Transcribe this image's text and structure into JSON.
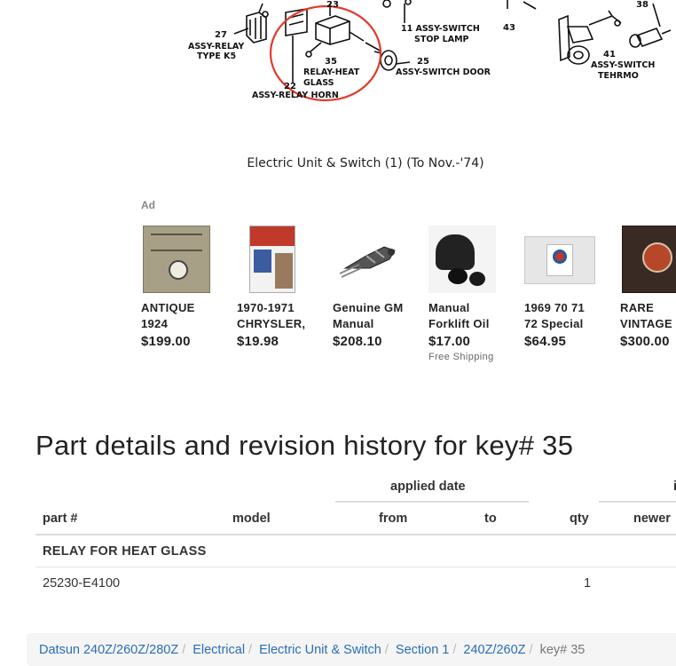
{
  "diagram": {
    "labels": {
      "n27": "27",
      "relay_k5_1": "ASSY-RELAY",
      "relay_k5_2": "TYPE K5",
      "n22": "22",
      "relay_horn": "ASSY-RELAY HORN",
      "n23": "23",
      "n35": "35",
      "relay_heat_1": "RELAY-HEAT",
      "relay_heat_2": "GLASS",
      "stop_1": "11 ASSY-SWITCH",
      "stop_2": "STOP LAMP",
      "n25": "25",
      "door": "ASSY-SWITCH DOOR",
      "n43": "43",
      "n38": "38",
      "n41": "41",
      "thermo_1": "ASSY-SWITCH",
      "thermo_2": "TEHRMO"
    },
    "caption": "Electric Unit & Switch (1) (To Nov.-'74)",
    "highlight_color": "#e03b2d"
  },
  "ad": {
    "label": "Ad",
    "items": [
      {
        "title_1": "ANTIQUE",
        "title_2": "1924",
        "price": "$199.00",
        "shipping": "",
        "thumb": "antique-parts-book"
      },
      {
        "title_1": "1970-1971",
        "title_2": "CHRYSLER,",
        "price": "$19.98",
        "shipping": "",
        "thumb": "chrysler-catalog"
      },
      {
        "title_1": "Genuine GM",
        "title_2": "Manual",
        "price": "$208.10",
        "shipping": "",
        "thumb": "gm-switch"
      },
      {
        "title_1": "Manual",
        "title_2": "Forklift Oil",
        "price": "$17.00",
        "shipping": "Free Shipping",
        "thumb": "forklift-knob"
      },
      {
        "title_1": "1969 70 71",
        "title_2": "72 Special",
        "price": "$64.95",
        "shipping": "",
        "thumb": "display-case"
      },
      {
        "title_1": "RARE",
        "title_2": "VINTAGE",
        "price": "$300.00",
        "shipping": "",
        "thumb": "vintage-binder"
      }
    ]
  },
  "details": {
    "heading": "Part details and revision history for key# 35",
    "group_applied": "applied date",
    "group_revision": "i",
    "columns": {
      "part": "part #",
      "model": "model",
      "from": "from",
      "to": "to",
      "qty": "qty",
      "newer": "newer"
    },
    "group_row": "RELAY FOR HEAT GLASS",
    "rows": [
      {
        "part": "25230-E4100",
        "model": "",
        "from": "",
        "to": "",
        "qty": "1",
        "newer": ""
      }
    ]
  },
  "breadcrumb": [
    "Datsun 240Z/260Z/280Z",
    "Electrical",
    "Electric Unit & Switch",
    "Section 1",
    "240Z/260Z",
    "key# 35"
  ],
  "breadcrumb_separator": "/"
}
